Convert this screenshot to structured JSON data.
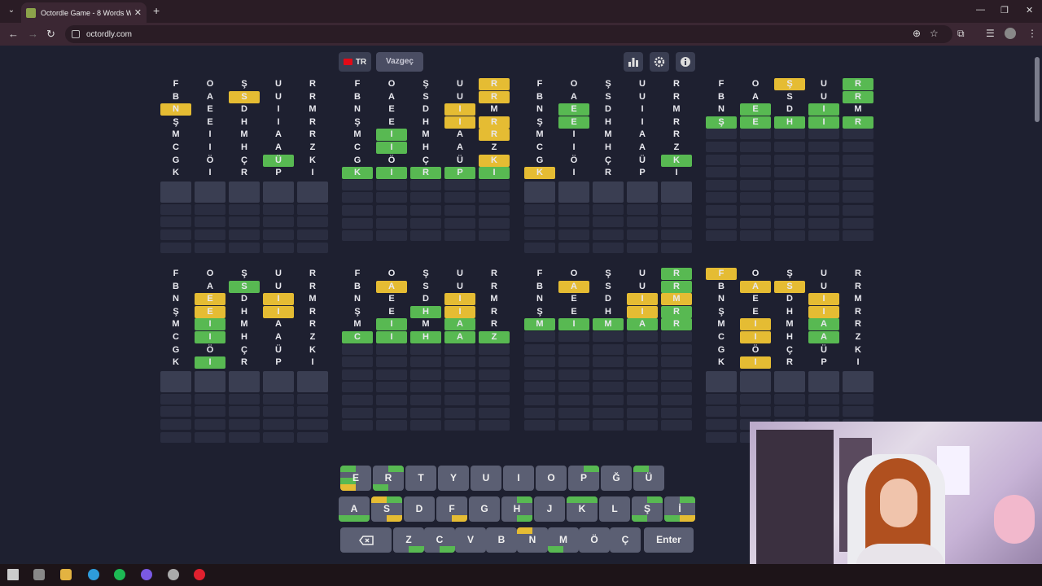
{
  "browser": {
    "tab_title": "Octordle Game - 8 Words Wordle",
    "url": "octordly.com"
  },
  "header": {
    "lang_label": "TR",
    "giveup_label": "Vazgeç"
  },
  "colors": {
    "green": "#58b952",
    "yellow": "#e5bc33",
    "background": "#1e2030",
    "key": "#5b5f73"
  },
  "icons": [
    "stats-icon",
    "settings-icon",
    "info-icon",
    "backspace-icon"
  ],
  "guesses": [
    "FOŞUR",
    "BASUR",
    "NEDIM",
    "ŞEHIR",
    "MIMAR",
    "CIHAZ",
    "GÖÇÜK",
    "KIRPI"
  ],
  "boards": [
    {
      "rows": [
        "-----",
        "--y--",
        "y----",
        "-----",
        "-----",
        "-----",
        "---g-",
        "-----"
      ],
      "letters": null
    },
    {
      "rows": [
        "----y",
        "----y",
        "---y-",
        "---yy",
        "-g--y",
        "-g---",
        "----y",
        "ggggg"
      ]
    },
    {
      "rows": [
        "-----",
        "-----",
        "-g---",
        "-g---",
        "-----",
        "-----",
        "----g",
        "y----"
      ]
    },
    {
      "rows": [
        "--y-g",
        "----g",
        "-g-g-",
        "ggggg"
      ]
    },
    {
      "rows": [
        "-----",
        "--g--",
        "-y-y-",
        "-y-y-",
        "-g---",
        "-g---",
        "-----",
        "-g---"
      ]
    },
    {
      "rows": [
        "-----",
        "-y---",
        "---y-",
        "--gy-",
        "-g-g-",
        "ggggg"
      ]
    },
    {
      "rows": [
        "----g",
        "-y--g",
        "---yy",
        "---yg",
        "ggggg"
      ]
    },
    {
      "rows": [
        "y----",
        "-yy--",
        "---y-",
        "---y-",
        "-y-g-",
        "-y-g-",
        "-----",
        "-y---"
      ]
    }
  ],
  "keyboard": {
    "row1": [
      {
        "k": "E",
        "m": [
          "tl:g",
          "bl:y",
          "bl2:g"
        ]
      },
      {
        "k": "R",
        "m": [
          "tr:g",
          "bl:g"
        ]
      },
      {
        "k": "T",
        "m": []
      },
      {
        "k": "Y",
        "m": []
      },
      {
        "k": "U",
        "m": []
      },
      {
        "k": "I",
        "m": []
      },
      {
        "k": "O",
        "m": []
      },
      {
        "k": "P",
        "m": [
          "tr:g"
        ]
      },
      {
        "k": "Ğ",
        "m": []
      },
      {
        "k": "Ü",
        "m": [
          "tl:g"
        ]
      }
    ],
    "row2": [
      {
        "k": "A",
        "m": [
          "bl:g",
          "br:g"
        ]
      },
      {
        "k": "S",
        "m": [
          "tl:y",
          "tr:g",
          "br:y"
        ]
      },
      {
        "k": "D",
        "m": []
      },
      {
        "k": "F",
        "m": [
          "br:y"
        ]
      },
      {
        "k": "G",
        "m": []
      },
      {
        "k": "H",
        "m": [
          "tr:g",
          "br:g"
        ]
      },
      {
        "k": "J",
        "m": []
      },
      {
        "k": "K",
        "m": [
          "tl:g",
          "tr:g"
        ]
      },
      {
        "k": "L",
        "m": []
      },
      {
        "k": "Ş",
        "m": [
          "tr:g",
          "bl:g"
        ]
      },
      {
        "k": "İ",
        "m": [
          "tr:g",
          "br:y",
          "bl:g"
        ]
      }
    ],
    "row3": [
      {
        "k": "Z",
        "m": [
          "br:g"
        ]
      },
      {
        "k": "C",
        "m": [
          "br:g"
        ]
      },
      {
        "k": "V",
        "m": []
      },
      {
        "k": "B",
        "m": []
      },
      {
        "k": "N",
        "m": [
          "tl:y"
        ]
      },
      {
        "k": "M",
        "m": [
          "bl:g"
        ]
      },
      {
        "k": "Ö",
        "m": []
      },
      {
        "k": "Ç",
        "m": []
      }
    ],
    "enter_label": "Enter"
  }
}
